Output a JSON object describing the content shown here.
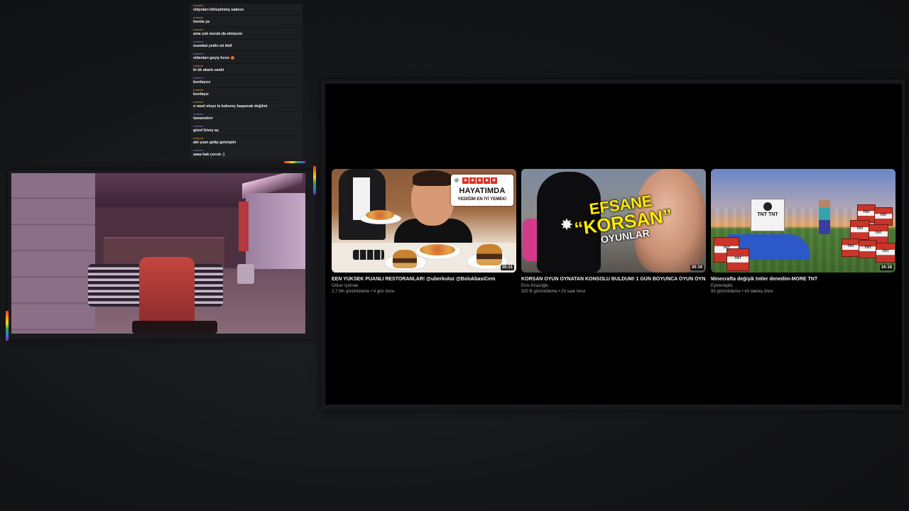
{
  "chat": {
    "messages": [
      {
        "user": "someone",
        "user_color": "#e0a040",
        "text": "vidyoları birleştirmiş sadece"
      },
      {
        "user": "someone",
        "user_color": "#e0a040",
        "text": "benda ya"
      },
      {
        "user": "someone",
        "user_color": "#e0a040",
        "text": "ama çok merak da etmiyom"
      },
      {
        "user": "someone",
        "user_color": "#9c7cd8",
        "text": "mumbai yedin mi Akif"
      },
      {
        "user": "someone",
        "user_color": "#9c7cd8",
        "text": "videoları geçiş hcnn",
        "emoji": true
      },
      {
        "user": "someone",
        "user_color": "#e0a040",
        "text": "bi ük abartı sanki"
      },
      {
        "user": "someone",
        "user_color": "#9c7cd8",
        "text": "burdayızz"
      },
      {
        "user": "someone",
        "user_color": "#e0a040",
        "text": "burdayız"
      },
      {
        "user": "someone",
        "user_color": "#e0a040",
        "text": "o nasıl oluyo la kokoreç başarsak değilmi"
      },
      {
        "user": "someone",
        "user_color": "#9c7cd8",
        "text": "tamamdırrr"
      },
      {
        "user": "someone",
        "user_color": "#9c7cd8",
        "text": "güzel bisey aç"
      },
      {
        "user": "someone",
        "user_color": "#e0a040",
        "text": "abi yuan gidip gelmiştin"
      },
      {
        "user": "someone",
        "user_color": "#9c7cd8",
        "text": "aaaa bak çocuk :)"
      }
    ]
  },
  "videos": [
    {
      "title": "EEN YÜKSEK PUANLI RESTORANLAR! @uberkuloz @BolukbasiCem",
      "channel": "Orkun Işıtmak",
      "meta": "2,7 Mn görüntüleme • 4 gün önce",
      "duration": "35:31",
      "thumb_title": "HAYATIMDA",
      "thumb_subtitle": "YEDİĞİM EN İYİ YEMEK!"
    },
    {
      "title": "KORSAN OYUN OYNATAN KONSOLU BULDUM! 1 GÜN BOYUNCA OYUN OYNADIM!",
      "channel": "Enis Kirazoğlu",
      "meta": "320 B görüntüleme • 23 saat önce",
      "duration": "30:19",
      "thumb_line1": "EFSANE",
      "thumb_line2": "“KORSAN”",
      "thumb_line3": "OYUNLAR"
    },
    {
      "title": "Minecrafta değişik tntler denedim-MORE TNT",
      "channel": "Eymenkplls",
      "meta": "93 görüntüleme • 43 dakika önce",
      "duration": "16:18",
      "tnt_label": "TNT",
      "sign_label": "TNT TNT"
    }
  ],
  "colors": {
    "background": "#151619",
    "panel": "#000000",
    "chat_row": "#1e1f22",
    "star": "#d93025",
    "thumb_text_yellow": "#ffeb00"
  },
  "icons": {
    "star": "★",
    "spider": "✸"
  }
}
